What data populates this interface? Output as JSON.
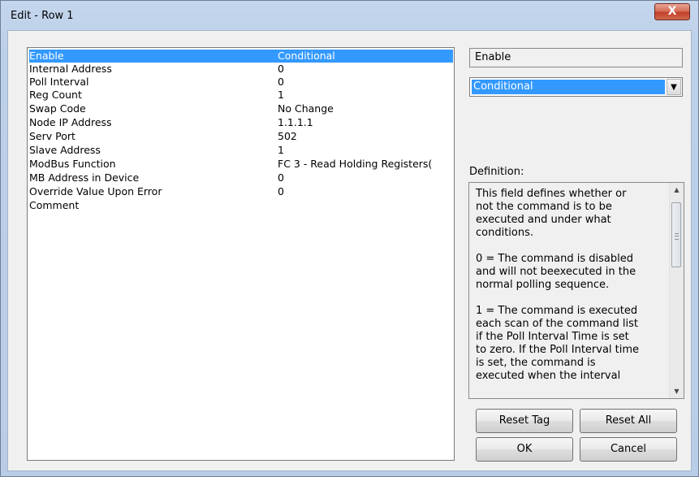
{
  "window": {
    "title": "Edit - Row 1",
    "close_glyph": "X"
  },
  "grid": {
    "rows": [
      {
        "key": "Enable",
        "value": "Conditional",
        "selected": true
      },
      {
        "key": "Internal Address",
        "value": "0"
      },
      {
        "key": "Poll Interval",
        "value": "0"
      },
      {
        "key": "Reg Count",
        "value": "1"
      },
      {
        "key": "Swap Code",
        "value": "No Change"
      },
      {
        "key": "Node IP Address",
        "value": "1.1.1.1"
      },
      {
        "key": "Serv Port",
        "value": "502"
      },
      {
        "key": "Slave Address",
        "value": "1"
      },
      {
        "key": "ModBus Function",
        "value": "FC 3 - Read Holding Registers("
      },
      {
        "key": "MB Address in Device",
        "value": "0"
      },
      {
        "key": "Override Value Upon Error",
        "value": "0"
      },
      {
        "key": "Comment",
        "value": ""
      }
    ]
  },
  "editor": {
    "field_name": "Enable",
    "value_selected": "Conditional",
    "definition_label": "Definition:",
    "definition_text": "This field defines whether or\nnot the command is to be\nexecuted and under what\nconditions.\n\n0 = The command is disabled\nand will not beexecuted in the\nnormal polling sequence.\n\n1 = The command is executed\neach scan of the command list\nif the Poll Interval Time is set\nto zero. If the Poll Interval time\nis set, the command is\nexecuted when the interval"
  },
  "buttons": {
    "reset_tag": "Reset Tag",
    "reset_all": "Reset All",
    "ok": "OK",
    "cancel": "Cancel"
  },
  "icons": {
    "combo_arrow": "▼",
    "scroll_up": "▲",
    "scroll_down": "▼"
  },
  "colors": {
    "selection": "#3399ff",
    "close_button": "#c74a34"
  }
}
